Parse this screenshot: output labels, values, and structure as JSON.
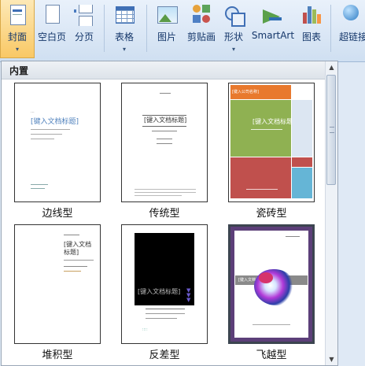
{
  "ribbon": {
    "buttons": [
      {
        "label": "封面",
        "icon": "cover-page-icon",
        "dropdown": "▾"
      },
      {
        "label": "空白页",
        "icon": "blank-page-icon"
      },
      {
        "label": "分页",
        "icon": "page-break-icon"
      },
      {
        "label": "表格",
        "icon": "table-icon",
        "dropdown": "▾"
      },
      {
        "label": "图片",
        "icon": "picture-icon"
      },
      {
        "label": "剪贴画",
        "icon": "clip-art-icon"
      },
      {
        "label": "形状",
        "icon": "shapes-icon",
        "dropdown": "▾"
      },
      {
        "label": "SmartArt",
        "icon": "smartart-icon"
      },
      {
        "label": "图表",
        "icon": "chart-icon"
      },
      {
        "label": "超链接",
        "icon": "hyperlink-icon"
      }
    ],
    "colors": {
      "active": "#f9c865",
      "blue": "#1f5fa8"
    }
  },
  "gallery": {
    "section_title": "内置",
    "items": [
      {
        "caption": "边线型",
        "title": "[键入文档标题]"
      },
      {
        "caption": "传统型",
        "title": "[键入文档标题]"
      },
      {
        "caption": "瓷砖型",
        "title": "[键入文档标题]"
      },
      {
        "caption": "堆积型",
        "title": "[键入文档\n标题]"
      },
      {
        "caption": "反差型",
        "title": "[键入文档标题]"
      },
      {
        "caption": "飞越型",
        "title": "[键入文档标题]"
      }
    ],
    "tile_colors": {
      "orange": "#e8792d",
      "green": "#8fb152",
      "red": "#c0504d",
      "blue": "#65b5d6"
    }
  }
}
